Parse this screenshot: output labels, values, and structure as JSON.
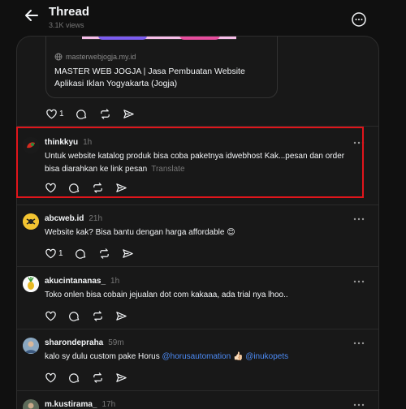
{
  "header": {
    "title": "Thread",
    "views": "3.1K views"
  },
  "link_card": {
    "url": "masterwebjogja.my.id",
    "title": "MASTER WEB JOGJA | Jasa Pembuatan Website Aplikasi Iklan Yogyakarta (Jogja)",
    "like_count": "1"
  },
  "posts": [
    {
      "username": "thinkkyu",
      "time": "1h",
      "text": "Untuk website katalog produk bisa coba paketnya idwebhost Kak...pesan dan order bisa diarahkan ke link pesan",
      "translate": "Translate"
    },
    {
      "username": "abcweb.id",
      "time": "21h",
      "text": "Website kak? Bisa bantu dengan harga affordable 😊",
      "like_count": "1"
    },
    {
      "username": "akucintananas_",
      "time": "1h",
      "text": "Toko onlen bisa cobain jejualan dot com kakaaa, ada trial nya lhoo.."
    },
    {
      "username": "sharondepraha",
      "time": "59m",
      "text_before": "kalo sy dulu custom pake Horus ",
      "mention1": "@horusautomation",
      "text_mid": " 👍🏻 ",
      "mention2": "@inukopets"
    },
    {
      "username": "m.kustirama_",
      "time": "17h"
    }
  ],
  "colors": {
    "highlight": "#e0151b",
    "mention": "#4c8bf5",
    "background": "#101010",
    "card": "#181818"
  },
  "icons": [
    "back-arrow-icon",
    "more-circle-icon",
    "globe-icon",
    "heart-icon",
    "comment-icon",
    "repost-icon",
    "share-icon",
    "more-dots-icon"
  ]
}
